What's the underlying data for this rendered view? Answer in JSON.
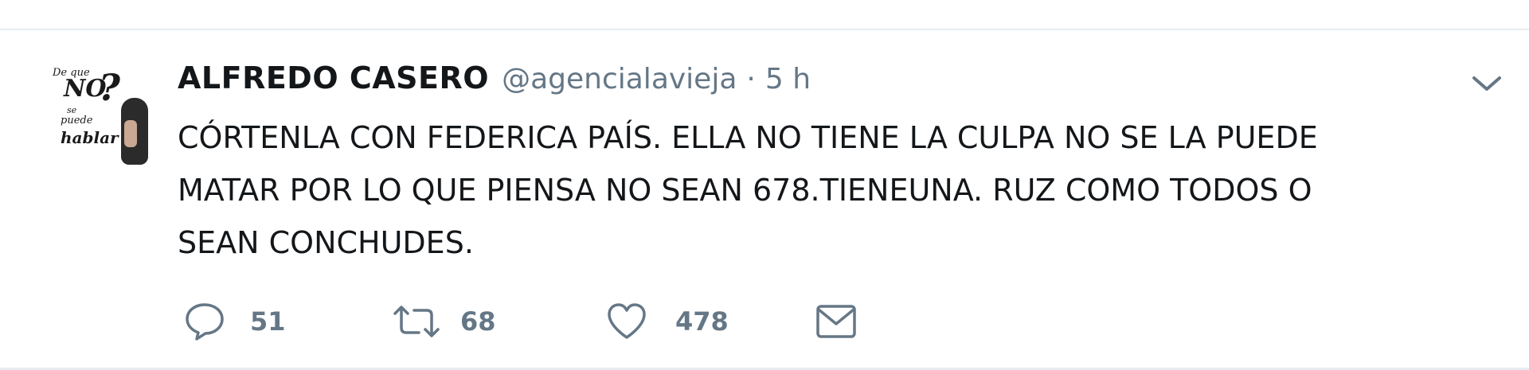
{
  "tweet": {
    "author_name": "ALFREDO CASERO",
    "handle": "@agencialavieja",
    "separator": "·",
    "time": "5 h",
    "text": "CÓRTENLA CON FEDERICA PAÍS. ELLA NO TIENE LA CULPA NO SE LA PUEDE\nMATAR POR LO QUE PIENSA NO SEAN 678.TIENEUNA. RUZ COMO TODOS O\nSEAN CONCHUDES.",
    "avatar": {
      "lines": [
        "De que",
        "NO",
        "se",
        "puede",
        "hablar"
      ],
      "question_mark": "?"
    },
    "actions": {
      "reply_count": "51",
      "retweet_count": "68",
      "like_count": "478"
    },
    "icons": {
      "reply": "reply-icon",
      "retweet": "retweet-icon",
      "like": "heart-icon",
      "dm": "envelope-icon",
      "more": "chevron-down-icon"
    },
    "colors": {
      "text": "#14171a",
      "secondary": "#657786",
      "border": "#e6ecf0"
    }
  }
}
